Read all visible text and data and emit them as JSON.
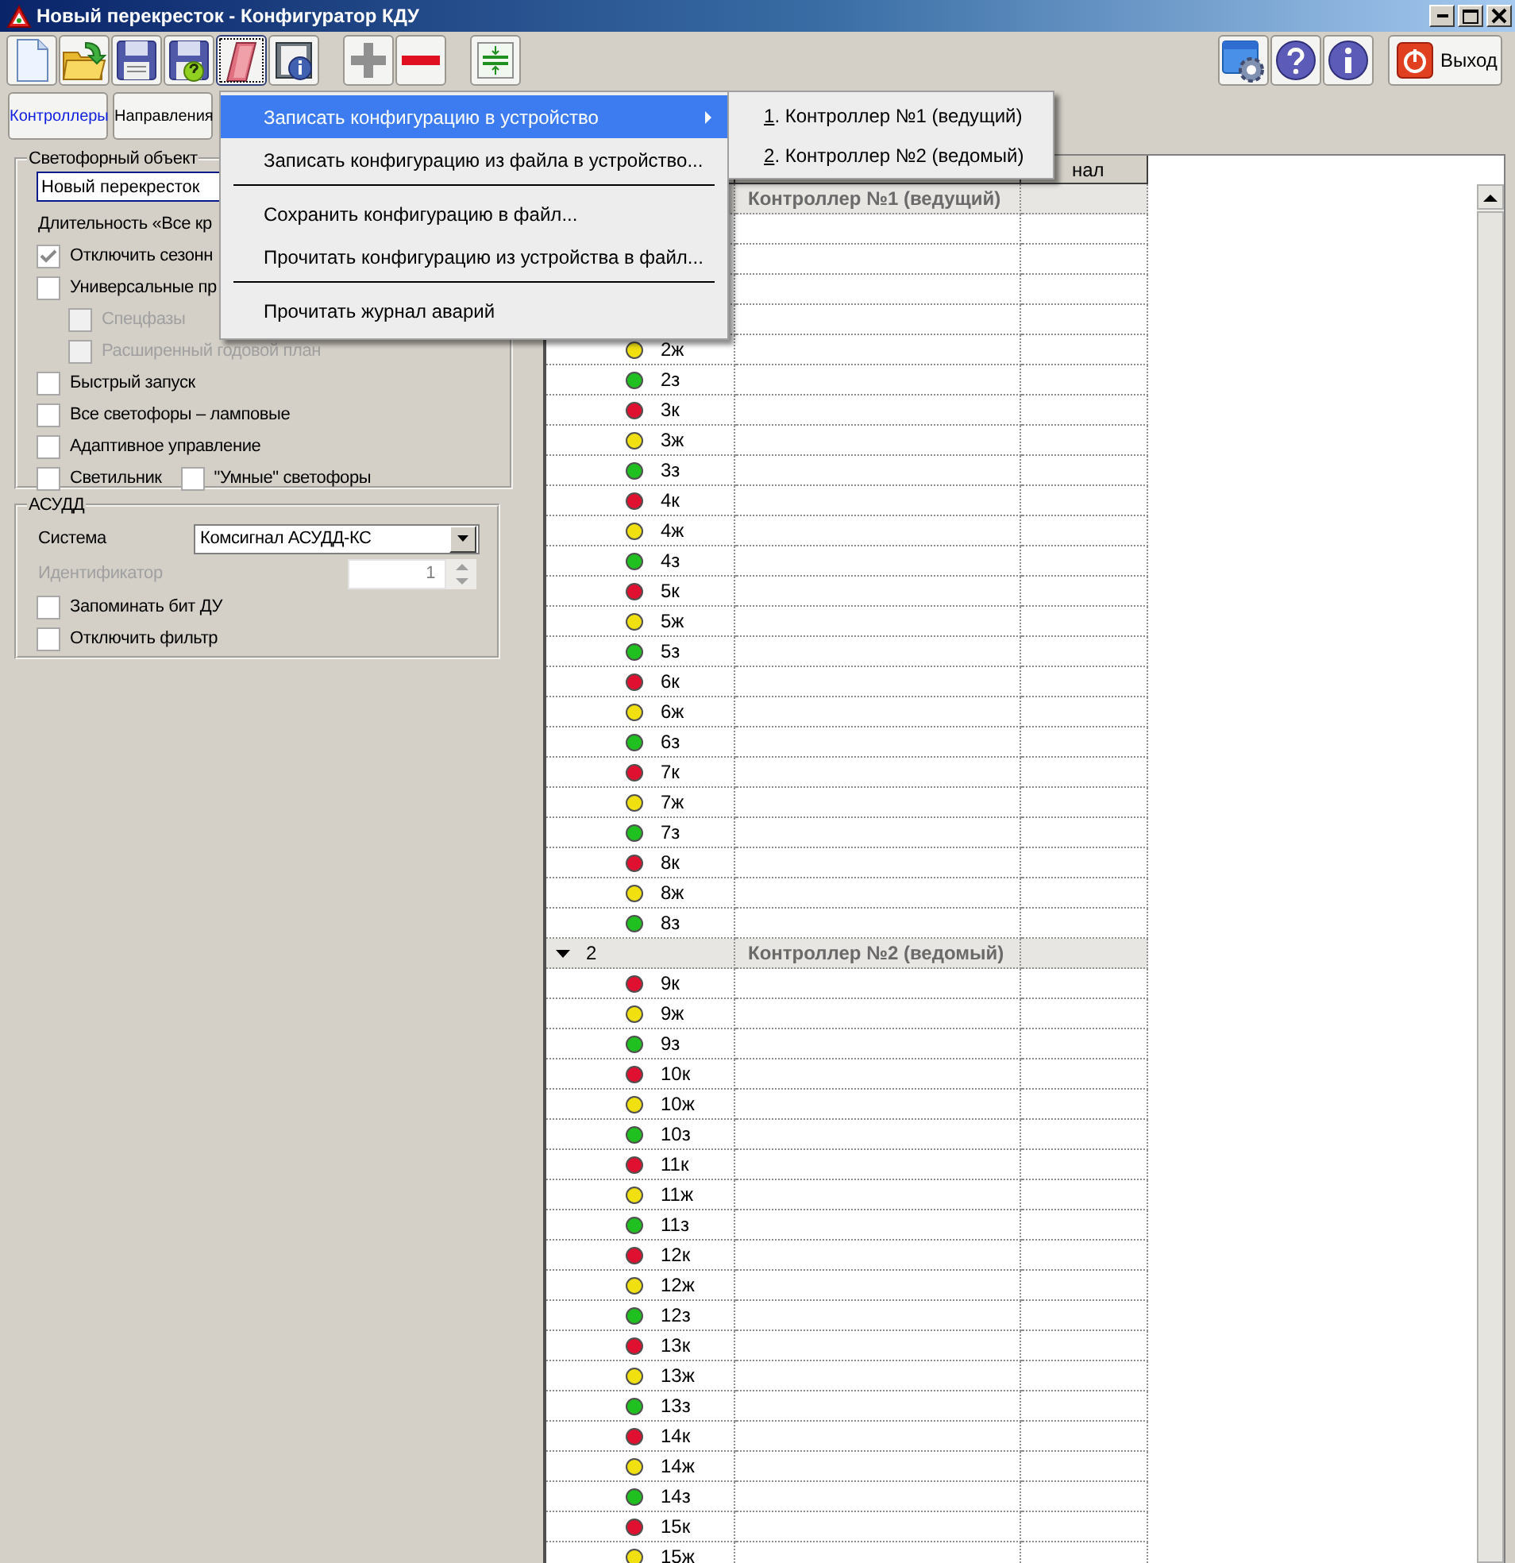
{
  "window": {
    "title": "Новый перекресток - Конфигуратор КДУ"
  },
  "toolbar": {
    "left_buttons": [
      {
        "kind": "new",
        "focused": false
      },
      {
        "kind": "open",
        "focused": false
      },
      {
        "kind": "save",
        "focused": false
      },
      {
        "kind": "save-check",
        "focused": false
      },
      {
        "kind": "eraser",
        "focused": true
      },
      {
        "kind": "book-info",
        "focused": false
      },
      {
        "kind": "gap"
      },
      {
        "kind": "add",
        "focused": false
      },
      {
        "kind": "remove",
        "focused": false
      },
      {
        "kind": "gap"
      },
      {
        "kind": "split",
        "focused": false
      }
    ],
    "right_buttons": [
      {
        "kind": "settings"
      },
      {
        "kind": "help"
      },
      {
        "kind": "info"
      }
    ],
    "exit_button": {
      "label": "Выход"
    }
  },
  "tabs": [
    {
      "label": "Контроллеры",
      "selected": true
    },
    {
      "label": "Направления",
      "selected": false
    }
  ],
  "traffic_object": {
    "title": "Светофорный объект",
    "name_value": "Новый перекресток",
    "duration_label": "Длительность «Все кр",
    "options": [
      {
        "label": "Отключить сезонн",
        "checked": true,
        "disabled": false
      },
      {
        "label": "Универсальные пр",
        "checked": false,
        "disabled": false,
        "children": [
          {
            "label": "Спецфазы",
            "checked": false,
            "disabled": true
          },
          {
            "label": "Расширенный годовой план",
            "checked": false,
            "disabled": true
          }
        ]
      },
      {
        "label": "Быстрый запуск",
        "checked": false,
        "disabled": false
      },
      {
        "label": "Все светофоры – ламповые",
        "checked": false,
        "disabled": false
      },
      {
        "label": "Адаптивное управление",
        "checked": false,
        "disabled": false
      },
      {
        "label": "Светильник",
        "checked": false,
        "disabled": false
      },
      {
        "label": "\"Умные\" светофоры",
        "checked": false,
        "disabled": false,
        "same_line": true
      }
    ]
  },
  "asudd": {
    "title": "АСУДД",
    "system_label": "Система",
    "system_value": "Комсигнал АСУДД-КС",
    "id_label": "Идентификатор",
    "id_value": "1",
    "id_disabled": true,
    "options": [
      {
        "label": "Запоминать бит ДУ",
        "checked": false,
        "disabled": false
      },
      {
        "label": "Отключить фильтр",
        "checked": false,
        "disabled": false
      }
    ]
  },
  "grid": {
    "column_3_header": "нал",
    "groups": [
      {
        "title": "Контроллер №1 (ведущий)",
        "rows": [
          {
            "kind": "blank"
          },
          {
            "kind": "blank"
          },
          {
            "kind": "blank"
          },
          {
            "kind": "blank"
          },
          {
            "kind": "signal",
            "label": "2ж",
            "color": "#f0e010"
          },
          {
            "kind": "signal",
            "label": "2з",
            "color": "#20c020"
          },
          {
            "kind": "signal",
            "label": "3к",
            "color": "#e01030"
          },
          {
            "kind": "signal",
            "label": "3ж",
            "color": "#f0e010"
          },
          {
            "kind": "signal",
            "label": "3з",
            "color": "#20c020"
          },
          {
            "kind": "signal",
            "label": "4к",
            "color": "#e01030"
          },
          {
            "kind": "signal",
            "label": "4ж",
            "color": "#f0e010"
          },
          {
            "kind": "signal",
            "label": "4з",
            "color": "#20c020"
          },
          {
            "kind": "signal",
            "label": "5к",
            "color": "#e01030"
          },
          {
            "kind": "signal",
            "label": "5ж",
            "color": "#f0e010"
          },
          {
            "kind": "signal",
            "label": "5з",
            "color": "#20c020"
          },
          {
            "kind": "signal",
            "label": "6к",
            "color": "#e01030"
          },
          {
            "kind": "signal",
            "label": "6ж",
            "color": "#f0e010"
          },
          {
            "kind": "signal",
            "label": "6з",
            "color": "#20c020"
          },
          {
            "kind": "signal",
            "label": "7к",
            "color": "#e01030"
          },
          {
            "kind": "signal",
            "label": "7ж",
            "color": "#f0e010"
          },
          {
            "kind": "signal",
            "label": "7з",
            "color": "#20c020"
          },
          {
            "kind": "signal",
            "label": "8к",
            "color": "#e01030"
          },
          {
            "kind": "signal",
            "label": "8ж",
            "color": "#f0e010"
          },
          {
            "kind": "signal",
            "label": "8з",
            "color": "#20c020"
          }
        ]
      },
      {
        "number": "2",
        "expanded": true,
        "title": "Контроллер №2 (ведомый)",
        "rows": [
          {
            "kind": "signal",
            "label": "9к",
            "color": "#e01030"
          },
          {
            "kind": "signal",
            "label": "9ж",
            "color": "#f0e010"
          },
          {
            "kind": "signal",
            "label": "9з",
            "color": "#20c020"
          },
          {
            "kind": "signal",
            "label": "10к",
            "color": "#e01030"
          },
          {
            "kind": "signal",
            "label": "10ж",
            "color": "#f0e010"
          },
          {
            "kind": "signal",
            "label": "10з",
            "color": "#20c020"
          },
          {
            "kind": "signal",
            "label": "11к",
            "color": "#e01030"
          },
          {
            "kind": "signal",
            "label": "11ж",
            "color": "#f0e010"
          },
          {
            "kind": "signal",
            "label": "11з",
            "color": "#20c020"
          },
          {
            "kind": "signal",
            "label": "12к",
            "color": "#e01030"
          },
          {
            "kind": "signal",
            "label": "12ж",
            "color": "#f0e010"
          },
          {
            "kind": "signal",
            "label": "12з",
            "color": "#20c020"
          },
          {
            "kind": "signal",
            "label": "13к",
            "color": "#e01030"
          },
          {
            "kind": "signal",
            "label": "13ж",
            "color": "#f0e010"
          },
          {
            "kind": "signal",
            "label": "13з",
            "color": "#20c020"
          },
          {
            "kind": "signal",
            "label": "14к",
            "color": "#e01030"
          },
          {
            "kind": "signal",
            "label": "14ж",
            "color": "#f0e010"
          },
          {
            "kind": "signal",
            "label": "14з",
            "color": "#20c020"
          },
          {
            "kind": "signal",
            "label": "15к",
            "color": "#e01030"
          },
          {
            "kind": "signal",
            "label": "15ж",
            "color": "#f0e010"
          }
        ]
      }
    ]
  },
  "menu": {
    "items": [
      {
        "kind": "item",
        "label": "Записать конфигурацию в устройство",
        "selected": true,
        "submenu": true
      },
      {
        "kind": "item",
        "label": "Записать конфигурацию из файла в устройство...",
        "selected": false,
        "submenu": false
      },
      {
        "kind": "separator"
      },
      {
        "kind": "item",
        "label": "Сохранить конфигурацию в файл...",
        "selected": false,
        "submenu": false
      },
      {
        "kind": "item",
        "label": "Прочитать конфигурацию из устройства в файл...",
        "selected": false,
        "submenu": false
      },
      {
        "kind": "separator"
      },
      {
        "kind": "item",
        "label": "Прочитать журнал аварий",
        "selected": false,
        "submenu": false
      }
    ],
    "submenu_items": [
      {
        "label": "1. Контроллер №1 (ведущий)",
        "mnemonic": true
      },
      {
        "label": "2. Контроллер №2 (ведомый)",
        "mnemonic": true
      }
    ]
  }
}
